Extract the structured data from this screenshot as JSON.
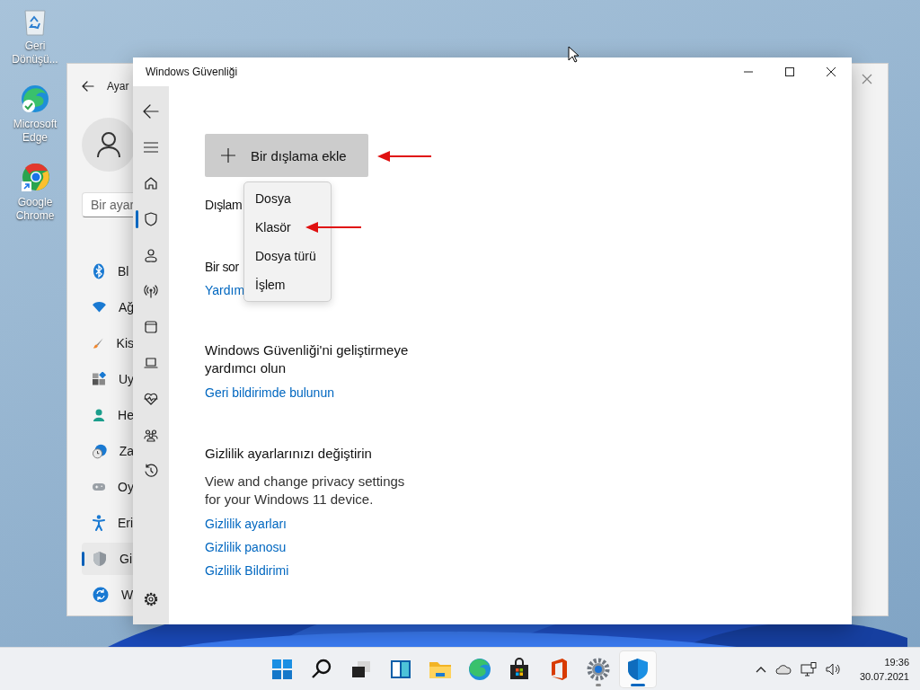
{
  "desktop_icons": [
    {
      "label": "Geri Dönüşü..."
    },
    {
      "label": "Microsoft Edge"
    },
    {
      "label": "Google Chrome"
    }
  ],
  "settings_window": {
    "title": "Ayar",
    "search_placeholder": "Bir ayar",
    "nav": [
      {
        "label": "Bl",
        "selected": false
      },
      {
        "label": "Ağ",
        "selected": false
      },
      {
        "label": "Kis",
        "selected": false
      },
      {
        "label": "Uy",
        "selected": false
      },
      {
        "label": "He",
        "selected": false
      },
      {
        "label": "Za",
        "selected": false
      },
      {
        "label": "Oy",
        "selected": false
      },
      {
        "label": "Eri",
        "selected": false
      },
      {
        "label": "Gi",
        "selected": true
      },
      {
        "label": "W",
        "selected": false
      }
    ]
  },
  "security_window": {
    "title": "Windows Güvenliği",
    "nav": [
      {
        "selected": false
      },
      {
        "selected": true
      },
      {
        "selected": false
      },
      {
        "selected": false
      },
      {
        "selected": false
      },
      {
        "selected": false
      },
      {
        "selected": false
      },
      {
        "selected": false
      },
      {
        "selected": false
      }
    ],
    "add_button": "Bir dışlama ekle",
    "exclusions_heading": "Dışlam",
    "question_heading": "Bir sor",
    "help_link": "Yardım",
    "improve_heading": "Windows Güvenliği'ni geliştirmeye yardımcı olun",
    "feedback_link": "Geri bildirimde bulunun",
    "privacy_heading": "Gizlilik ayarlarınızı değiştirin",
    "privacy_text": "View and change privacy settings for your Windows 11 device.",
    "privacy_links": [
      "Gizlilik ayarları",
      "Gizlilik panosu",
      "Gizlilik Bildirimi"
    ],
    "menu": [
      "Dosya",
      "Klasör",
      "Dosya türü",
      "İşlem"
    ]
  },
  "taskbar": {
    "apps": [
      {
        "selected": false,
        "running": false
      },
      {
        "selected": false,
        "running": false
      },
      {
        "selected": false,
        "running": false
      },
      {
        "selected": false,
        "running": false
      },
      {
        "selected": false,
        "running": false
      },
      {
        "selected": false,
        "running": false
      },
      {
        "selected": false,
        "running": false
      },
      {
        "selected": false,
        "running": false
      },
      {
        "selected": false,
        "running": true
      },
      {
        "selected": true,
        "running": true
      }
    ],
    "time": "19:36",
    "date": "30.07.2021"
  }
}
